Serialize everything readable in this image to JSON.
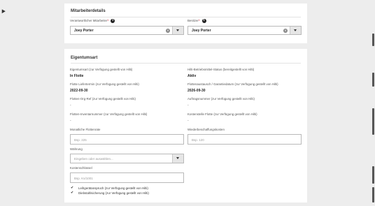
{
  "details": {
    "title": "Mitarbeiterdetails",
    "responsible_label": "Verantwortlicher Mitarbeiter",
    "responsible_value": "Joey Porter",
    "owner_label": "Besitzer",
    "owner_value": "Joey Porter",
    "required_mark": "*",
    "info_glyph": "i",
    "clear_glyph": "✕"
  },
  "ownership": {
    "title": "Eigentumsart",
    "ownership_type_label": "Eigentumsart (zur Verfügung gestellt von Hilti)",
    "ownership_type_value": "In Flotte",
    "service_status_label": "Hilti-Betriebsmittel-Status (bereitgestellt von Hilti)",
    "service_status_value": "Aktiv",
    "fleet_delivery_label": "Flotte Liefertermin (zur Verfügung gestellt von Hilti)",
    "fleet_delivery_value": "2022-09-30",
    "fleet_exchange_label": "Flottenaustausch / Garantiedatum (zur Verfügung gestellt von Hilti)",
    "fleet_exchange_value": "2026-09-30",
    "fleet_org_label": "Flotten-Org-Ref (zur Verfügung gestellt von Hilti)",
    "fleet_org_value": "-",
    "order_number_label": "Auftragsnummer (zur Verfügung gestellt von Hilti)",
    "order_number_value": "-",
    "fleet_inventory_label": "Flotten-Inventarnummer (zur Verfügung gestellt von Hilti)",
    "fleet_inventory_value": "-",
    "cost_center_label": "Kostenstelle Flotte (zur Verfügung gestellt von Hilti)",
    "cost_center_value": "-",
    "monthly_rate_label": "Monatliche Flottenrate",
    "monthly_rate_placeholder": "Bsp. 225",
    "replacement_cost_label": "Wiederbeschaffungskosten",
    "replacement_cost_placeholder": "Bsp. 120",
    "currency_label": "Währung",
    "currency_placeholder": "Eingeben oder auswählen...",
    "cost_code_label": "Kostenschlüssel",
    "cost_code_placeholder": "Bsp. Ks/1001",
    "check_glyph": "✔",
    "loan_claim_label": "Leihgerätanspruch (zur Verfügung gestellt von Hilti)",
    "theft_insurance_label": "Diebstahlsicherung (zur Verfügung gestellt von Hilti)"
  }
}
